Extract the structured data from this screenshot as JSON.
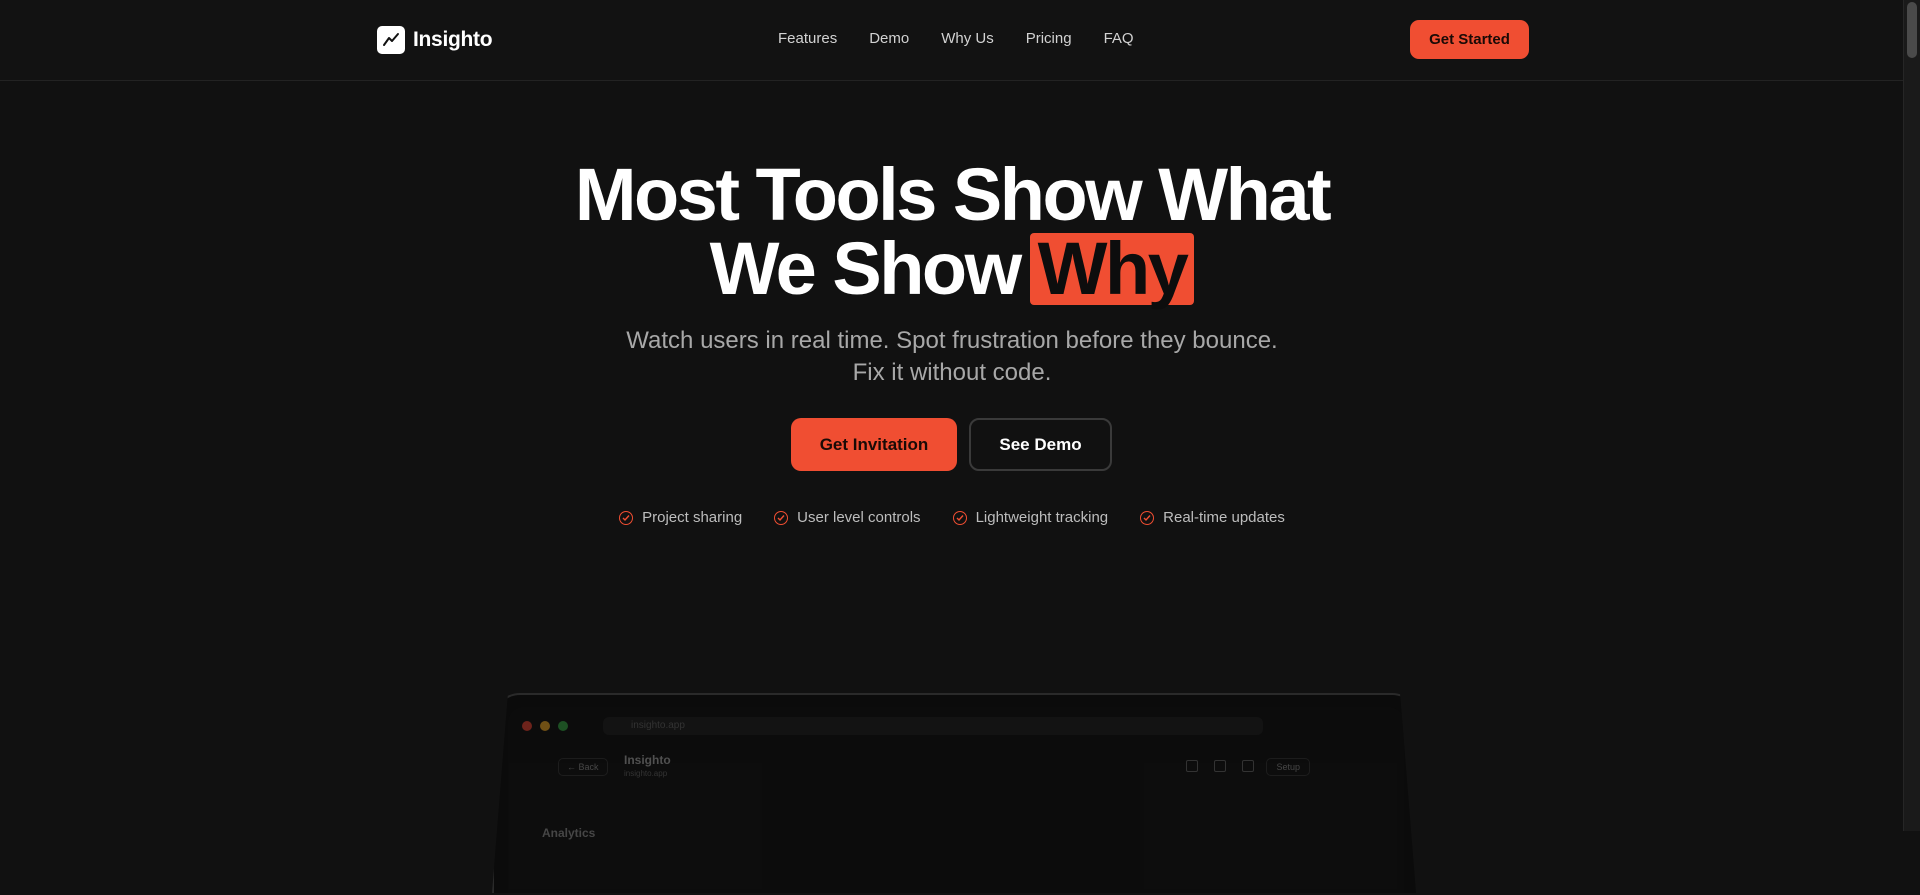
{
  "header": {
    "brand": "Insighto",
    "nav": [
      "Features",
      "Demo",
      "Why Us",
      "Pricing",
      "FAQ"
    ],
    "cta": "Get Started"
  },
  "hero": {
    "title_line1": "Most Tools Show What",
    "title_line2_prefix": "We Show",
    "title_highlight": "Why",
    "subtitle_line1": "Watch users in real time. Spot frustration before they bounce.",
    "subtitle_line2": "Fix it without code.",
    "primary_cta": "Get Invitation",
    "secondary_cta": "See Demo",
    "features": [
      "Project sharing",
      "User level controls",
      "Lightweight tracking",
      "Real-time updates"
    ]
  },
  "mockup": {
    "url": "insighto.app",
    "back": "Back",
    "app_title": "Insighto",
    "app_subtitle": "insighto.app",
    "setup": "Setup",
    "section": "Analytics"
  },
  "colors": {
    "accent": "#f04e32",
    "background": "#111111",
    "text": "#ffffff",
    "muted": "#a8a8a8"
  }
}
